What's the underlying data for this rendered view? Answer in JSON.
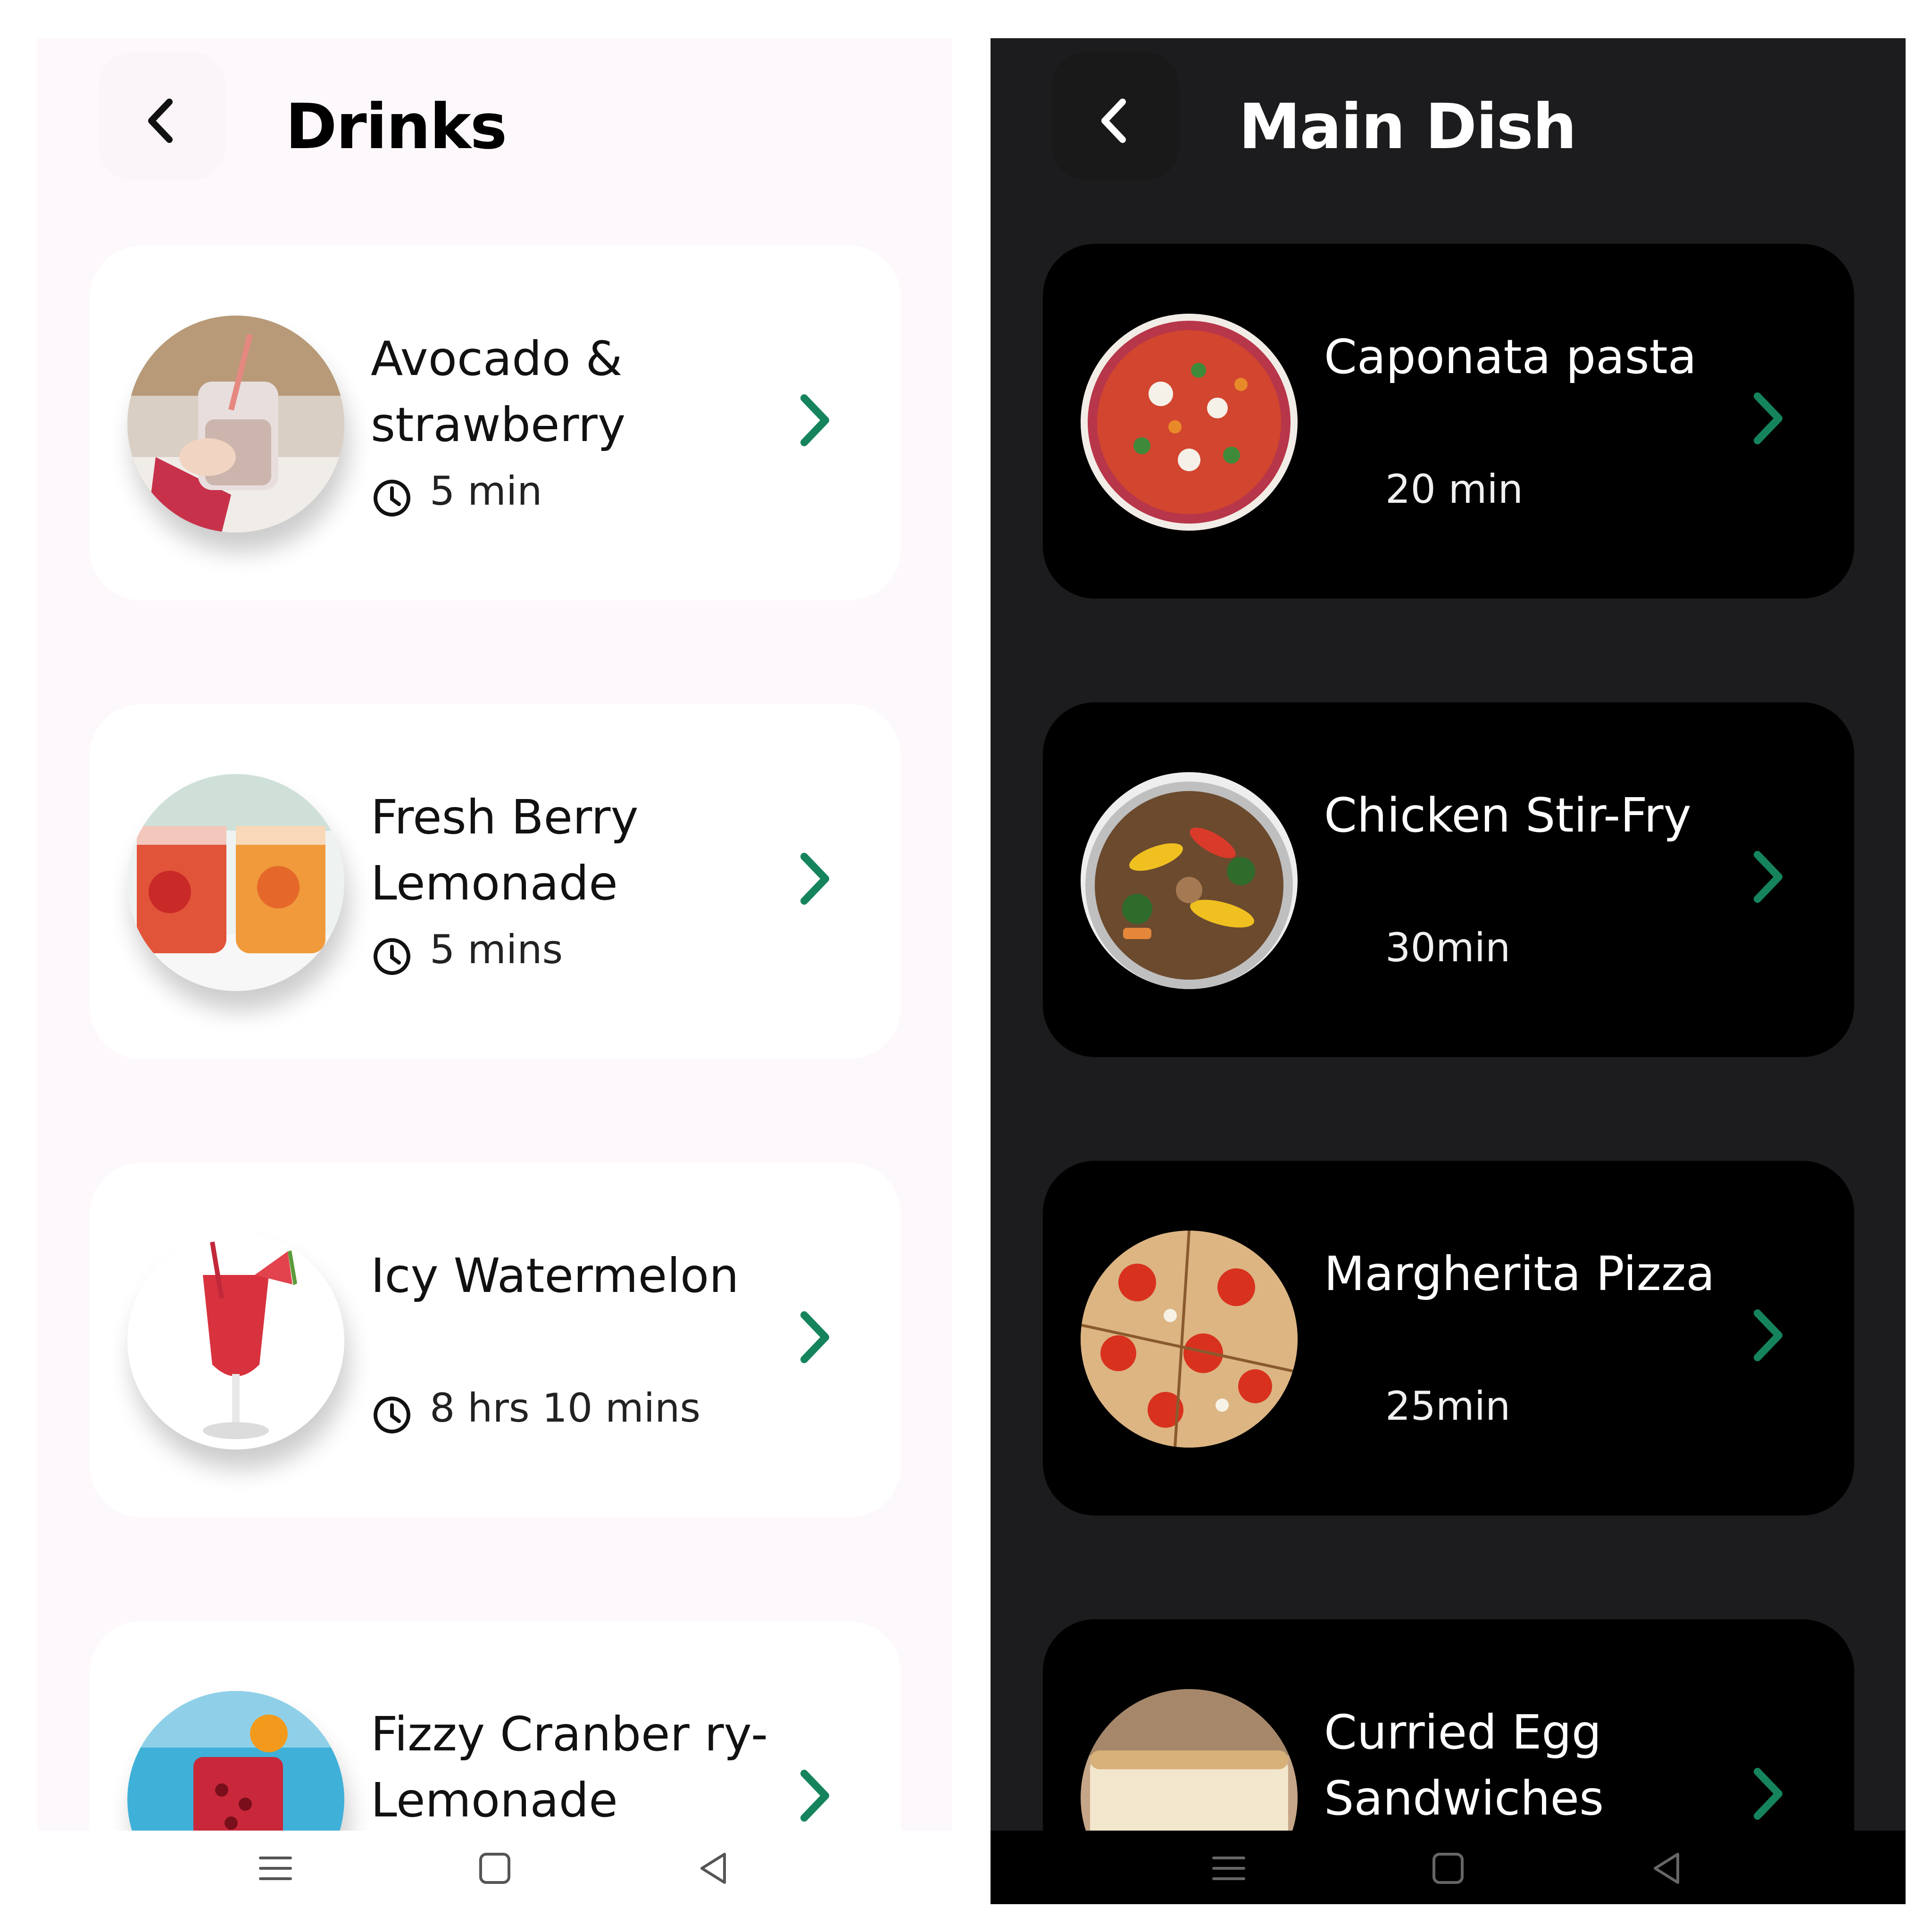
{
  "drinks": {
    "title": "Drinks",
    "items": [
      {
        "name": "Avocado & strawberry",
        "time": "5 min"
      },
      {
        "name": "Fresh Berry Lemonade",
        "time": "5 mins"
      },
      {
        "name": "Icy Watermelon",
        "time": "8 hrs 10 mins"
      },
      {
        "name": "Fizzy Cranber ry-Lemonade",
        "time": ""
      }
    ]
  },
  "main_dish": {
    "title": "Main Dish",
    "items": [
      {
        "name": "Caponata pasta",
        "time": "20 min"
      },
      {
        "name": "Chicken Stir-Fry",
        "time": "30min"
      },
      {
        "name": "Margherita Pizza",
        "time": "25min"
      },
      {
        "name": "Curried Egg Sandwiches",
        "time": ""
      }
    ]
  },
  "colors": {
    "accent": "#15845c",
    "light_background": "#fdf8fb",
    "dark_background": "#1c1c1e",
    "dark_card": "#000000"
  },
  "icons": [
    "back-chevron-icon",
    "clock-icon",
    "chevron-right-icon",
    "menu-icon",
    "home-square-icon",
    "back-triangle-icon"
  ]
}
